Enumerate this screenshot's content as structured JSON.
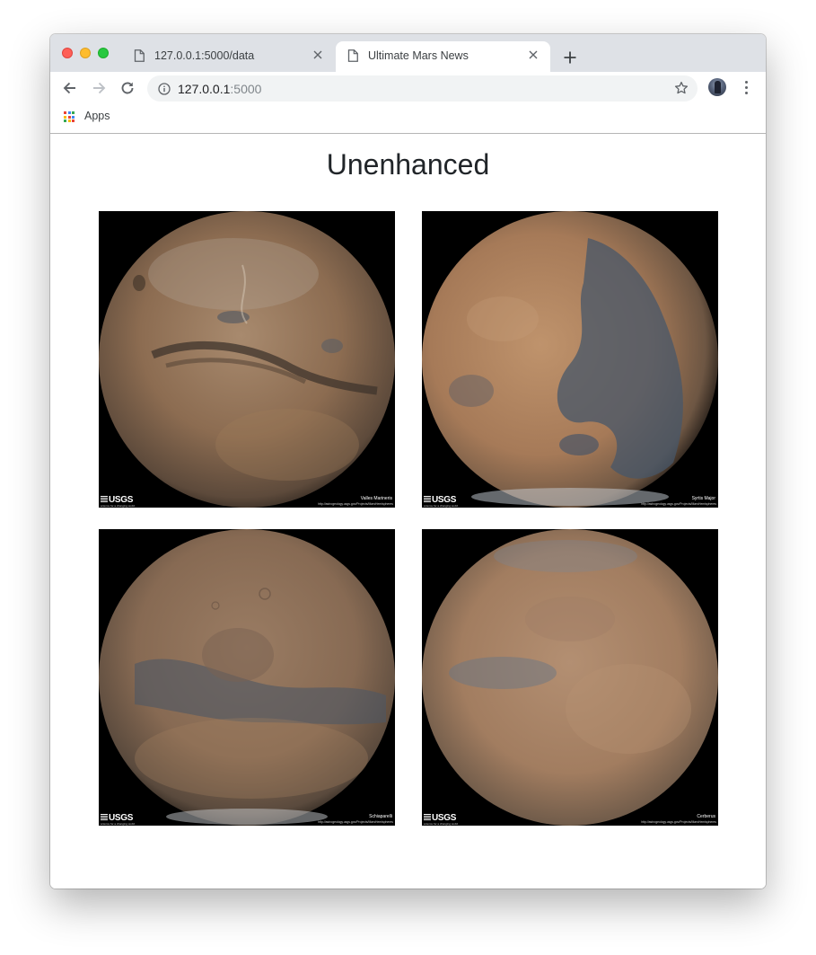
{
  "browser": {
    "tabs": [
      {
        "title": "127.0.0.1:5000/data",
        "active": false
      },
      {
        "title": "Ultimate Mars News",
        "active": true
      }
    ],
    "address": {
      "host": "127.0.0.1",
      "port": ":5000"
    },
    "bookmarks": {
      "apps_label": "Apps"
    }
  },
  "page": {
    "heading": "Unenhanced",
    "hemispheres": [
      {
        "name": "Valles Marineris",
        "logo": "USGS",
        "source": "http://astrogeology.usgs.gov/Projects/MarsHemispheres"
      },
      {
        "name": "Syrtis Major",
        "logo": "USGS",
        "source": "http://astrogeology.usgs.gov/Projects/MarsHemispheres"
      },
      {
        "name": "Schiaparelli",
        "logo": "USGS",
        "source": "http://astrogeology.usgs.gov/Projects/MarsHemispheres"
      },
      {
        "name": "Cerberus",
        "logo": "USGS",
        "source": "http://astrogeology.usgs.gov/Projects/MarsHemispheres"
      }
    ],
    "logo_tagline": "science for a changing world"
  },
  "colors": {
    "tabstrip": "#dee1e6",
    "omnibox": "#f1f3f4",
    "mars_light": "#b78d68",
    "mars_dark": "#4f5e6c"
  }
}
